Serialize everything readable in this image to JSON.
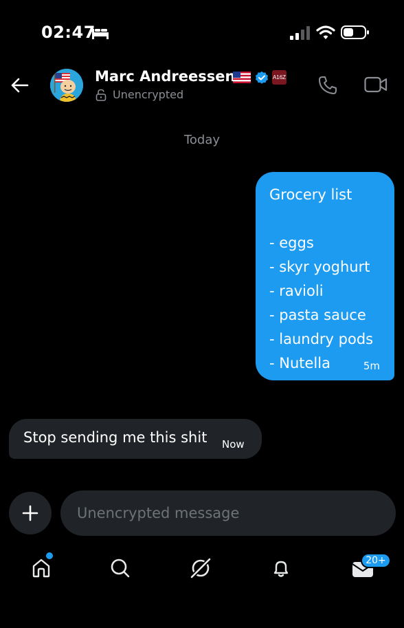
{
  "status_bar": {
    "time": "02:47",
    "icons": [
      "bed-icon",
      "signal-icon",
      "wifi-icon",
      "battery-icon"
    ]
  },
  "header": {
    "contact_name": "Marc Andreessen",
    "encryption_status": "Unencrypted",
    "affiliate_badge": "A16Z",
    "icons": [
      "back-arrow-icon",
      "avatar",
      "us-flag-icon",
      "verified-icon",
      "lock-icon",
      "phone-icon",
      "video-icon"
    ],
    "verified_color": "#1d9bf0"
  },
  "conversation": {
    "date_divider": "Today",
    "messages": [
      {
        "direction": "sent",
        "lines": [
          "Grocery list",
          "",
          "- eggs",
          "- skyr yoghurt",
          "- ravioli",
          "- pasta sauce",
          "- laundry pods",
          "- Nutella"
        ],
        "time": "5m",
        "bubble_color": "#1d9bf0"
      },
      {
        "direction": "received",
        "text": "Stop sending me this shit",
        "time": "Now",
        "bubble_color": "#202327"
      }
    ]
  },
  "composer": {
    "placeholder": "Unencrypted message",
    "value": ""
  },
  "bottom_nav": {
    "items": [
      "home-icon",
      "search-icon",
      "grok-icon",
      "notifications-icon",
      "messages-icon"
    ],
    "messages_badge": "20+",
    "accent_color": "#1d9bf0"
  }
}
